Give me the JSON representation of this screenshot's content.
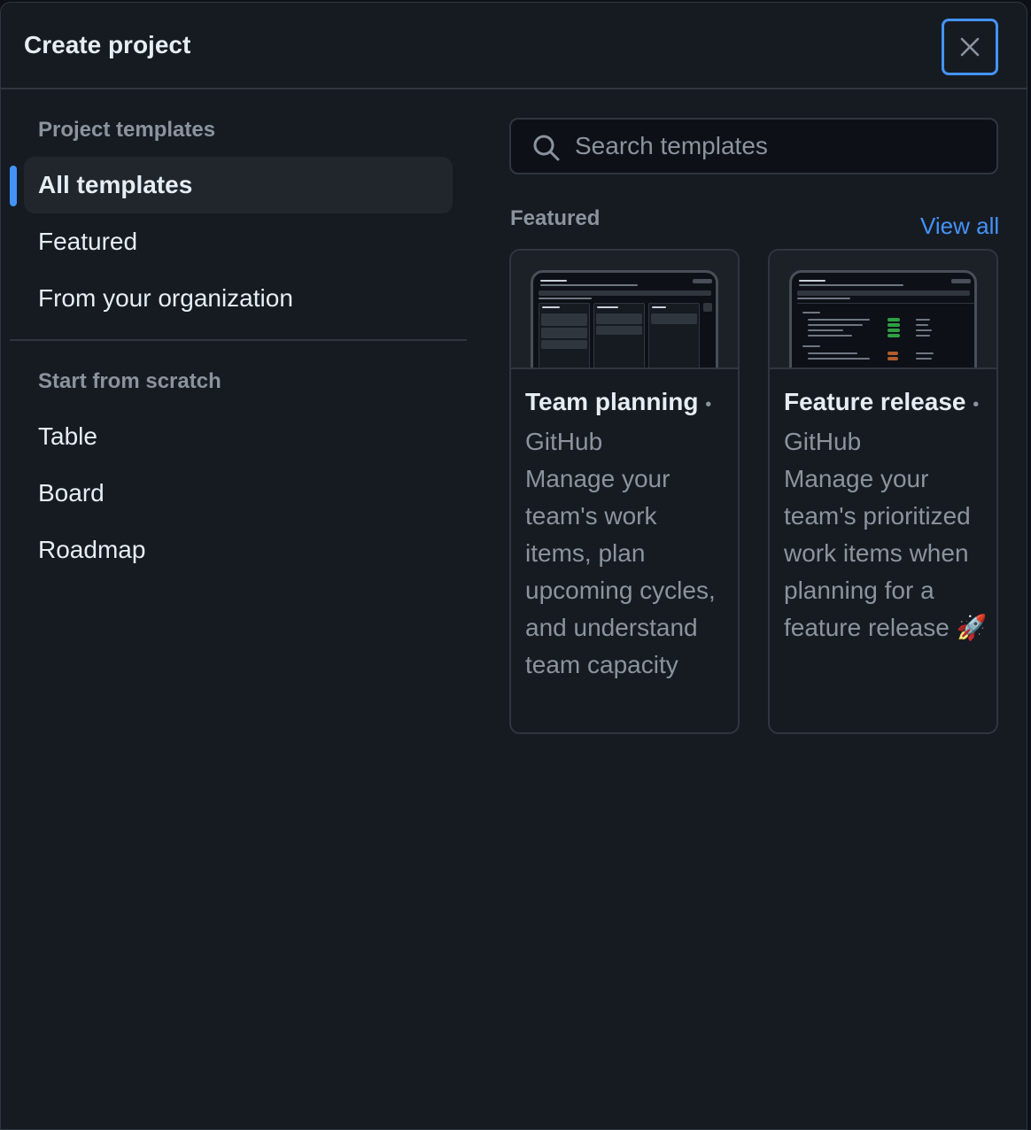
{
  "dialog": {
    "title": "Create project",
    "close_icon": "close-icon"
  },
  "sidebar": {
    "templates_heading": "Project templates",
    "template_items": [
      {
        "label": "All templates",
        "active": true
      },
      {
        "label": "Featured",
        "active": false
      },
      {
        "label": "From your organization",
        "active": false
      }
    ],
    "scratch_heading": "Start from scratch",
    "scratch_items": [
      {
        "label": "Table"
      },
      {
        "label": "Board"
      },
      {
        "label": "Roadmap"
      }
    ]
  },
  "search": {
    "placeholder": "Search templates",
    "value": "",
    "icon": "search-icon"
  },
  "featured": {
    "heading": "Featured",
    "view_all": "View all",
    "cards": [
      {
        "title": "Team planning",
        "separator": "•",
        "owner": "GitHub",
        "description": "Manage your team's work items, plan upcoming cycles, and understand team capacity",
        "preview_title": "Team planning"
      },
      {
        "title": "Feature release",
        "separator": "•",
        "owner": "GitHub",
        "description": "Manage your team's prioritized work items when planning for a feature release",
        "emoji": "🚀",
        "preview_title": "Feature release"
      }
    ]
  },
  "colors": {
    "background": "#161b22",
    "border": "#30363d",
    "text": "#e6edf3",
    "muted": "#8b949e",
    "accent": "#4493f8"
  }
}
